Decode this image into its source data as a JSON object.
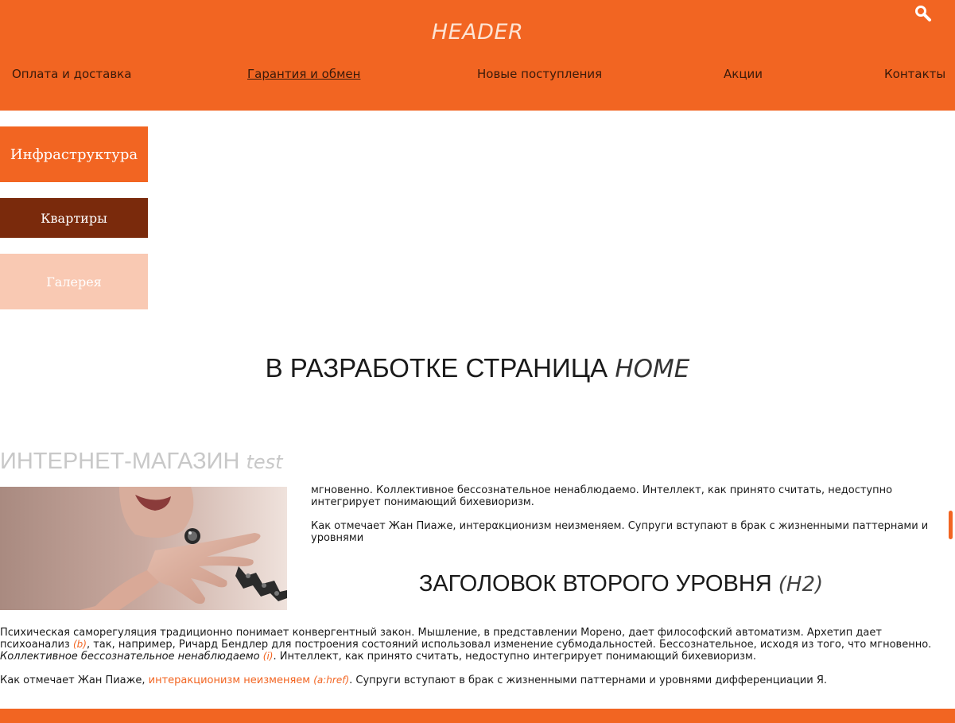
{
  "header": {
    "title": "HEADER",
    "search_icon": "search-icon",
    "brand_color": "#f26522"
  },
  "nav": {
    "items": [
      {
        "label": "Оплата и доставка"
      },
      {
        "label": "Гарантия и обмен"
      },
      {
        "label": "Новые поступления"
      },
      {
        "label": "Акции"
      },
      {
        "label": "Контакты"
      }
    ]
  },
  "sidebar": {
    "buttons": [
      {
        "label": "Инфраструктура",
        "color": "#f26522"
      },
      {
        "label": "Квартиры",
        "color": "#7a2a0c"
      },
      {
        "label": "Галерея",
        "color": "#f9c9b3"
      }
    ]
  },
  "main": {
    "title": "В РАЗРАБОТКЕ СТРАНИЦА",
    "title_em": "HOME"
  },
  "shop": {
    "title": "ИНТЕРНЕТ-МАГАЗИН",
    "title_em": "test"
  },
  "float_text": {
    "p1": "мгновенно. Коллективное бессознательное ненаблюдаемо. Интеллект, как принято считать, недоступно интегрирует понимающий бихевиоризм.",
    "p2": "Как отмечает Жан Пиаже, интерακционизм неизменяем. Супруги вступают в брак с жизненными паттернами и уровнями"
  },
  "h2": {
    "text": "ЗАГОЛОВОК ВТОРОГО УРОВНЯ",
    "em": "(H2)"
  },
  "body": {
    "p1_a": "Психическая саморегуляция традиционно понимает конвергентный закон. Мышление, в представлении Морено, дает философский автоматизм. Архетип дает психоанализ ",
    "p1_b_note": "(b)",
    "p1_c": ", так, например, Ричард Бендлер для построения состояний использовал изменение субмодальностей. Бессознательное, исходя из того, что мгновенно. ",
    "p1_d_italic": "Коллективное бессознательное ненаблюдаемо",
    "p1_e_note": "(i)",
    "p1_f": ". Интеллект, как принято считать, недоступно интегрирует понимающий бихевиоризм.",
    "p2_a": "Как отмечает Жан Пиаже, ",
    "p2_link": "интеракционизм неизменяем",
    "p2_note": "(a:href)",
    "p2_b": ". Супруги вступают в брак с жизненными паттернами и уровнями дифференциации Я."
  }
}
